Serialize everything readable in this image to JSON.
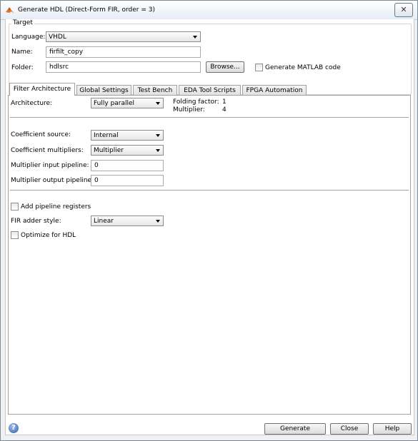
{
  "window": {
    "title": "Generate HDL (Direct-Form FIR, order = 3)",
    "close": "✕"
  },
  "target": {
    "group_label": "Target",
    "language_label": "Language:",
    "language_value": "VHDL",
    "name_label": "Name:",
    "name_value": "firfilt_copy",
    "folder_label": "Folder:",
    "folder_value": "hdlsrc",
    "browse_label": "Browse...",
    "matlab_label": "Generate MATLAB code",
    "matlab_checked": false
  },
  "tabs": [
    {
      "label": "Filter Architecture",
      "active": true
    },
    {
      "label": "Global Settings",
      "active": false
    },
    {
      "label": "Test Bench",
      "active": false
    },
    {
      "label": "EDA Tool Scripts",
      "active": false
    },
    {
      "label": "FPGA Automation",
      "active": false
    }
  ],
  "filter_arch": {
    "architecture_label": "Architecture:",
    "architecture_value": "Fully parallel",
    "folding_label": "Folding factor:",
    "folding_value": "1",
    "multiplier_label": "Multiplier:",
    "multiplier_value": "4",
    "coeff_source_label": "Coefficient source:",
    "coeff_source_value": "Internal",
    "coeff_mult_label": "Coefficient multipliers:",
    "coeff_mult_value": "Multiplier",
    "mult_in_label": "Multiplier input pipeline:",
    "mult_in_value": "0",
    "mult_out_label": "Multiplier output pipeline:",
    "mult_out_value": "0",
    "pipeline_label": "Add pipeline registers",
    "pipeline_checked": false,
    "adder_label": "FIR adder style:",
    "adder_value": "Linear",
    "optimize_label": "Optimize for HDL",
    "optimize_checked": false
  },
  "footer": {
    "help_icon": "?",
    "generate_label": "Generate",
    "close_label": "Close",
    "help_label": "Help"
  },
  "colors": {
    "title_gradient_top": "#ffffff",
    "title_gradient_bottom": "#e6edf5",
    "help_icon": "#2f5fa7"
  }
}
